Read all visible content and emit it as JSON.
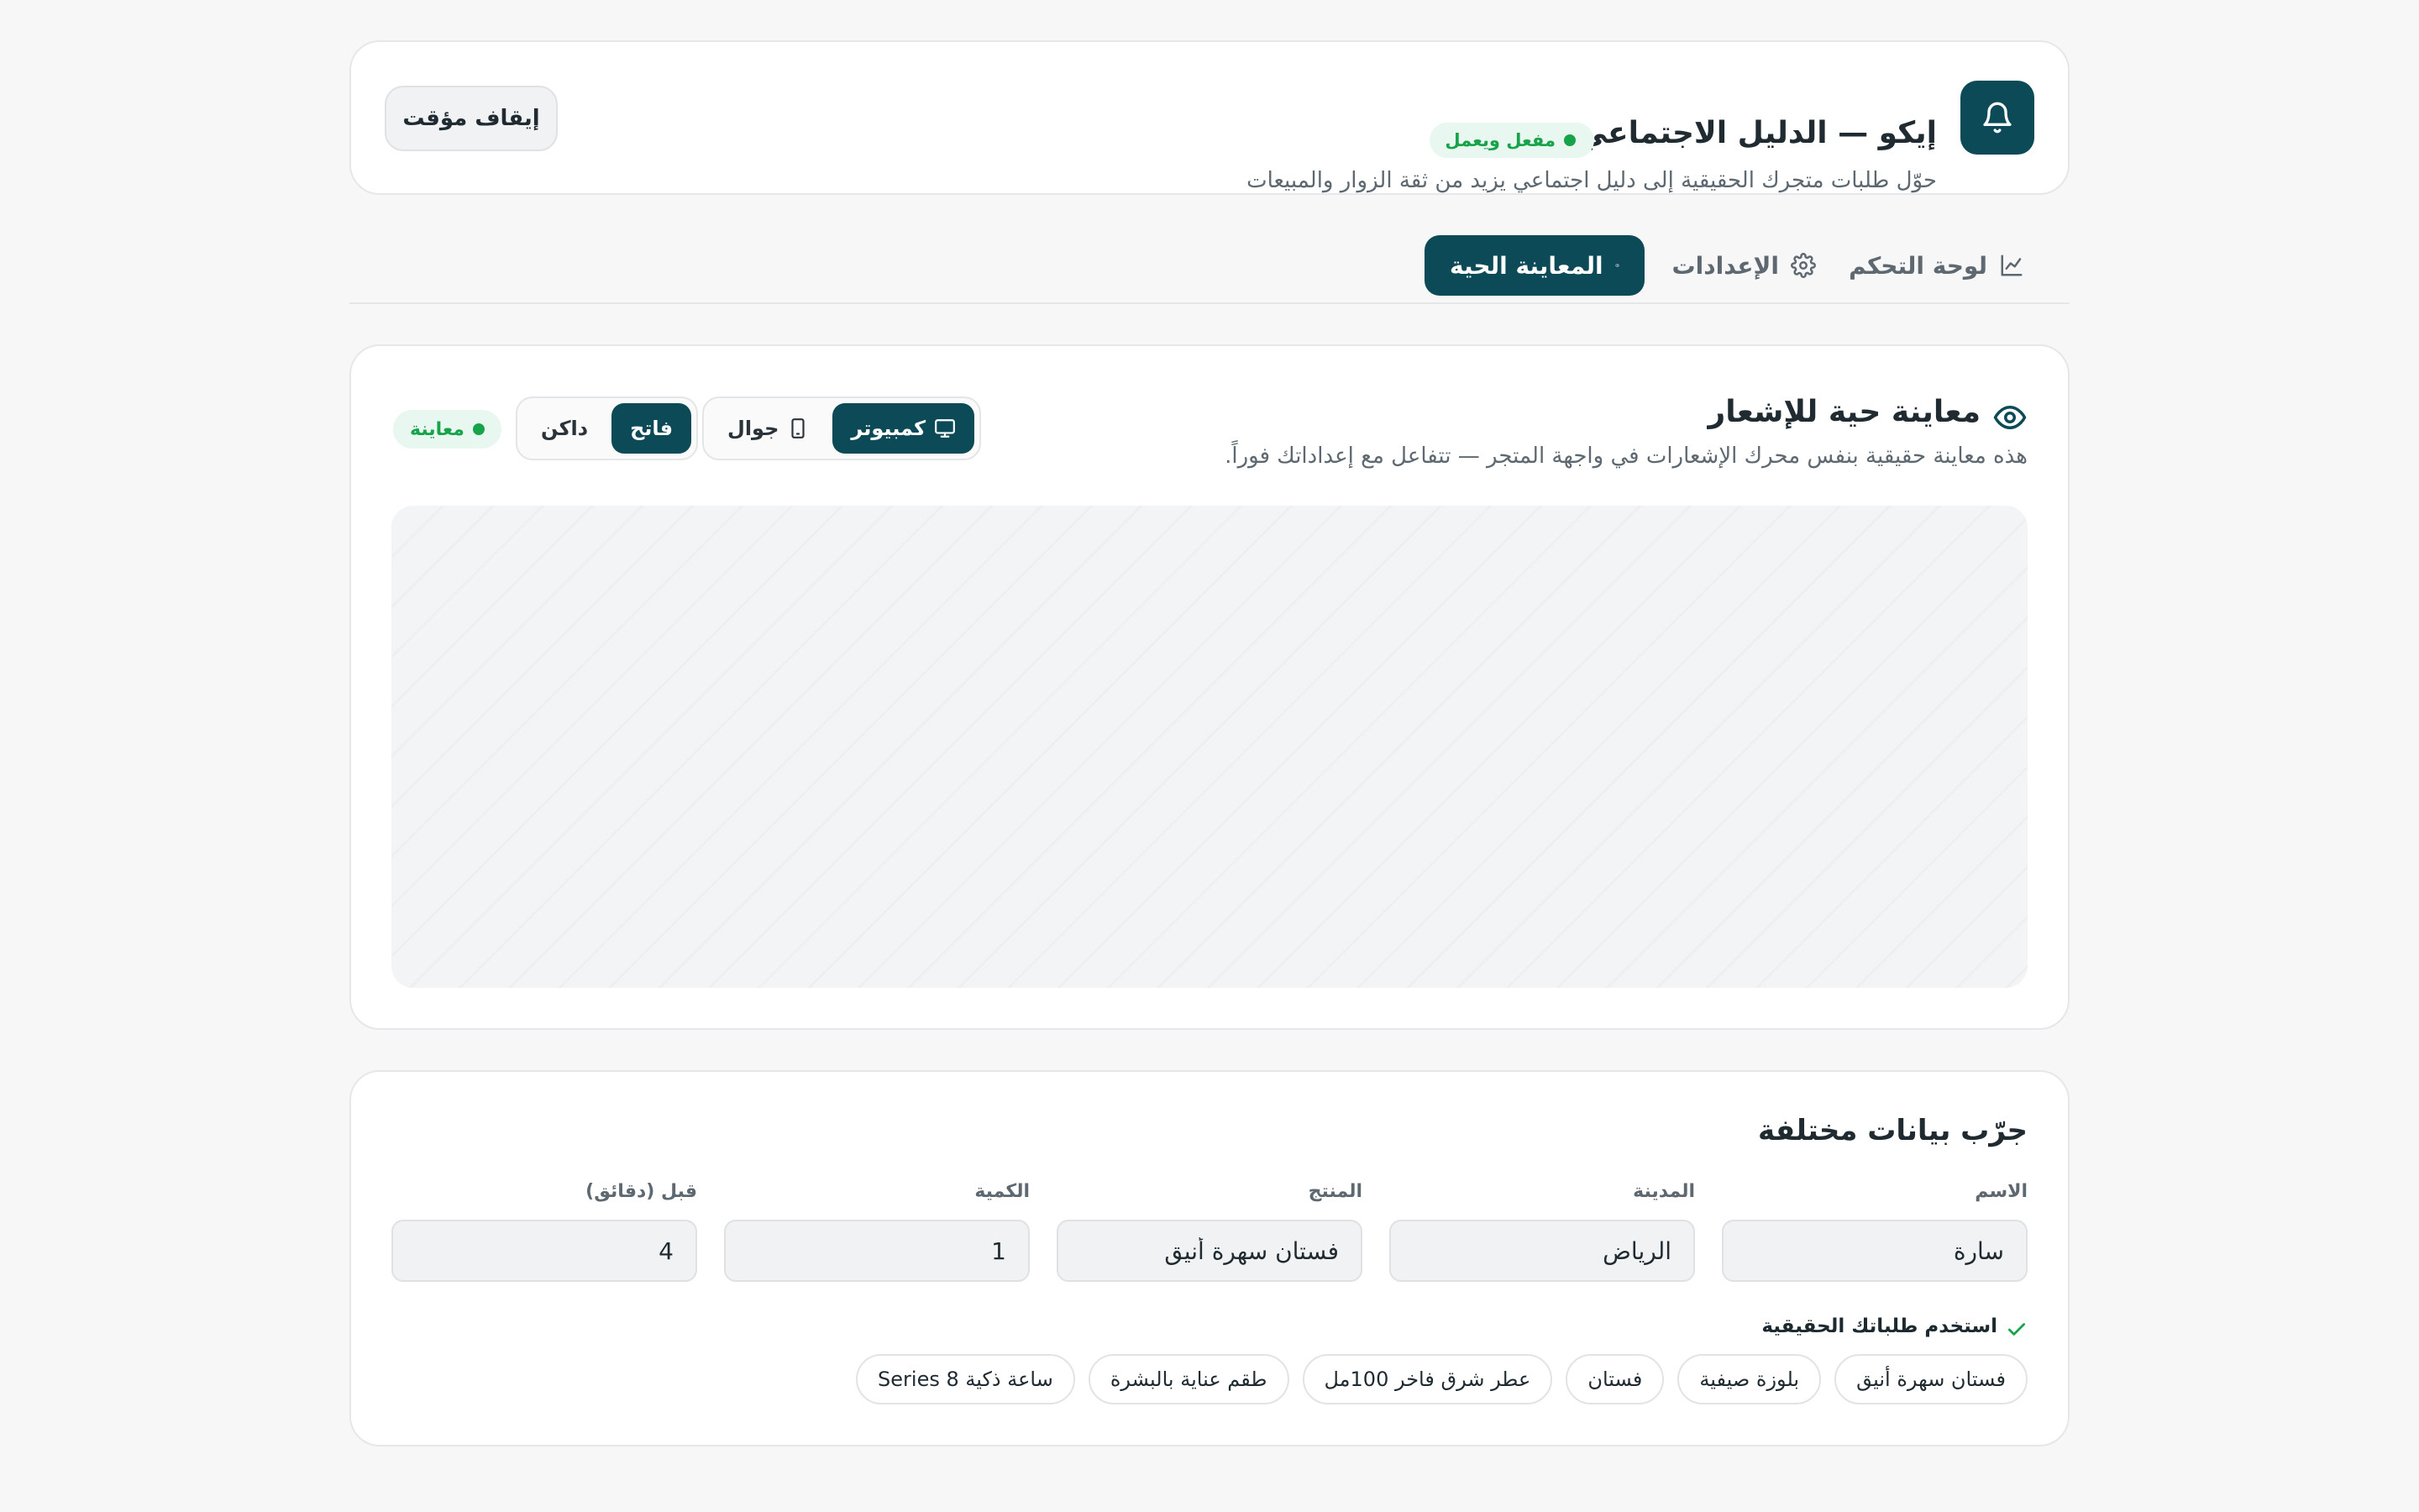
{
  "header": {
    "title": "إيكو — الدليل الاجتماعي",
    "status_badge": "مفعل ويعمل",
    "subtitle": "حوّل طلبات متجرك الحقيقية إلى دليل اجتماعي يزيد من ثقة الزوار والمبيعات",
    "pause_button": "إيقاف مؤقت"
  },
  "tabs": [
    {
      "label": "لوحة التحكم",
      "icon": "chart-line-icon"
    },
    {
      "label": "الإعدادات",
      "icon": "gear-icon"
    },
    {
      "label": "المعاينة الحية",
      "icon": "eye-icon",
      "active": true
    }
  ],
  "preview": {
    "title": "معاينة حية للإشعار",
    "subtitle": "هذه معاينة حقيقية بنفس محرك الإشعارات في واجهة المتجر — تتفاعل مع إعداداتك فوراً.",
    "device": {
      "desktop": "كمبيوتر",
      "mobile": "جوال",
      "selected": "desktop"
    },
    "theme": {
      "light": "فاتح",
      "dark": "داكن",
      "selected": "light"
    },
    "badge": "معاينة"
  },
  "sample": {
    "title": "جرّب بيانات مختلفة",
    "fields": [
      {
        "label": "الاسم",
        "value": "سارة"
      },
      {
        "label": "المدينة",
        "value": "الرياض"
      },
      {
        "label": "المنتج",
        "value": "فستان سهرة أنيق"
      },
      {
        "label": "الكمية",
        "value": "1"
      },
      {
        "label": "قبل (دقائق)",
        "value": "4"
      }
    ],
    "use_real_label": "استخدم طلباتك الحقيقية",
    "products": [
      "فستان سهرة أنيق",
      "بلوزة صيفية",
      "فستان",
      "عطر شرق فاخر 100مل",
      "طقم عناية بالبشرة",
      "ساعة ذكية Series 8"
    ]
  },
  "colors": {
    "primary": "#0b4a56",
    "success": "#16a34a",
    "background": "#f7f7f8"
  }
}
